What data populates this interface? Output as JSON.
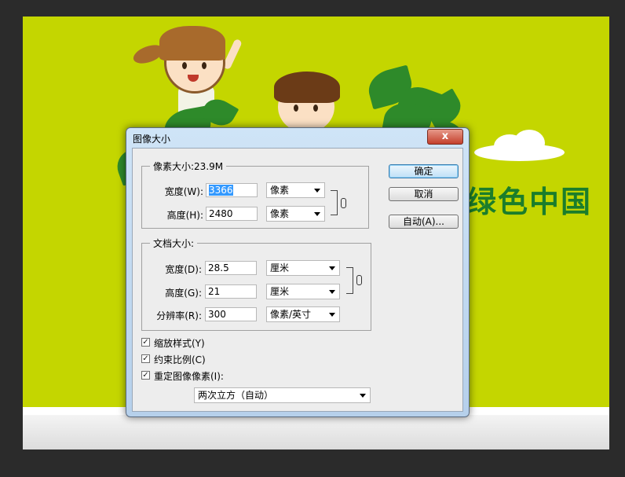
{
  "dialog": {
    "title": "图像大小",
    "close_glyph": "x",
    "pixel_dimensions": {
      "label": "像素大小:23.9M",
      "width_label": "宽度(W):",
      "width_value_selected": "3366",
      "width_unit": "像素",
      "height_label": "高度(H):",
      "height_value": "2480",
      "height_unit": "像素"
    },
    "document_size": {
      "label": "文档大小:",
      "width_label": "宽度(D):",
      "width_value": "28.5",
      "width_unit": "厘米",
      "height_label": "高度(G):",
      "height_value": "21",
      "height_unit": "厘米",
      "resolution_label": "分辨率(R):",
      "resolution_value": "300",
      "resolution_unit": "像素/英寸"
    },
    "buttons": {
      "ok": "确定",
      "cancel": "取消",
      "auto": "自动(A)..."
    },
    "checkboxes": {
      "scale_styles": {
        "label": "缩放样式(Y)",
        "checked": true
      },
      "constrain_proportions": {
        "label": "约束比例(C)",
        "checked": true
      },
      "resample_image": {
        "label": "重定图像像素(I):",
        "checked": true
      }
    },
    "resample_method": "两次立方（自动）"
  },
  "artwork": {
    "banner_text": "绿色中国",
    "colors": {
      "background": "#c4d600",
      "banner_text": "#1b7d2b",
      "leaves": "#2e8a2a"
    }
  }
}
